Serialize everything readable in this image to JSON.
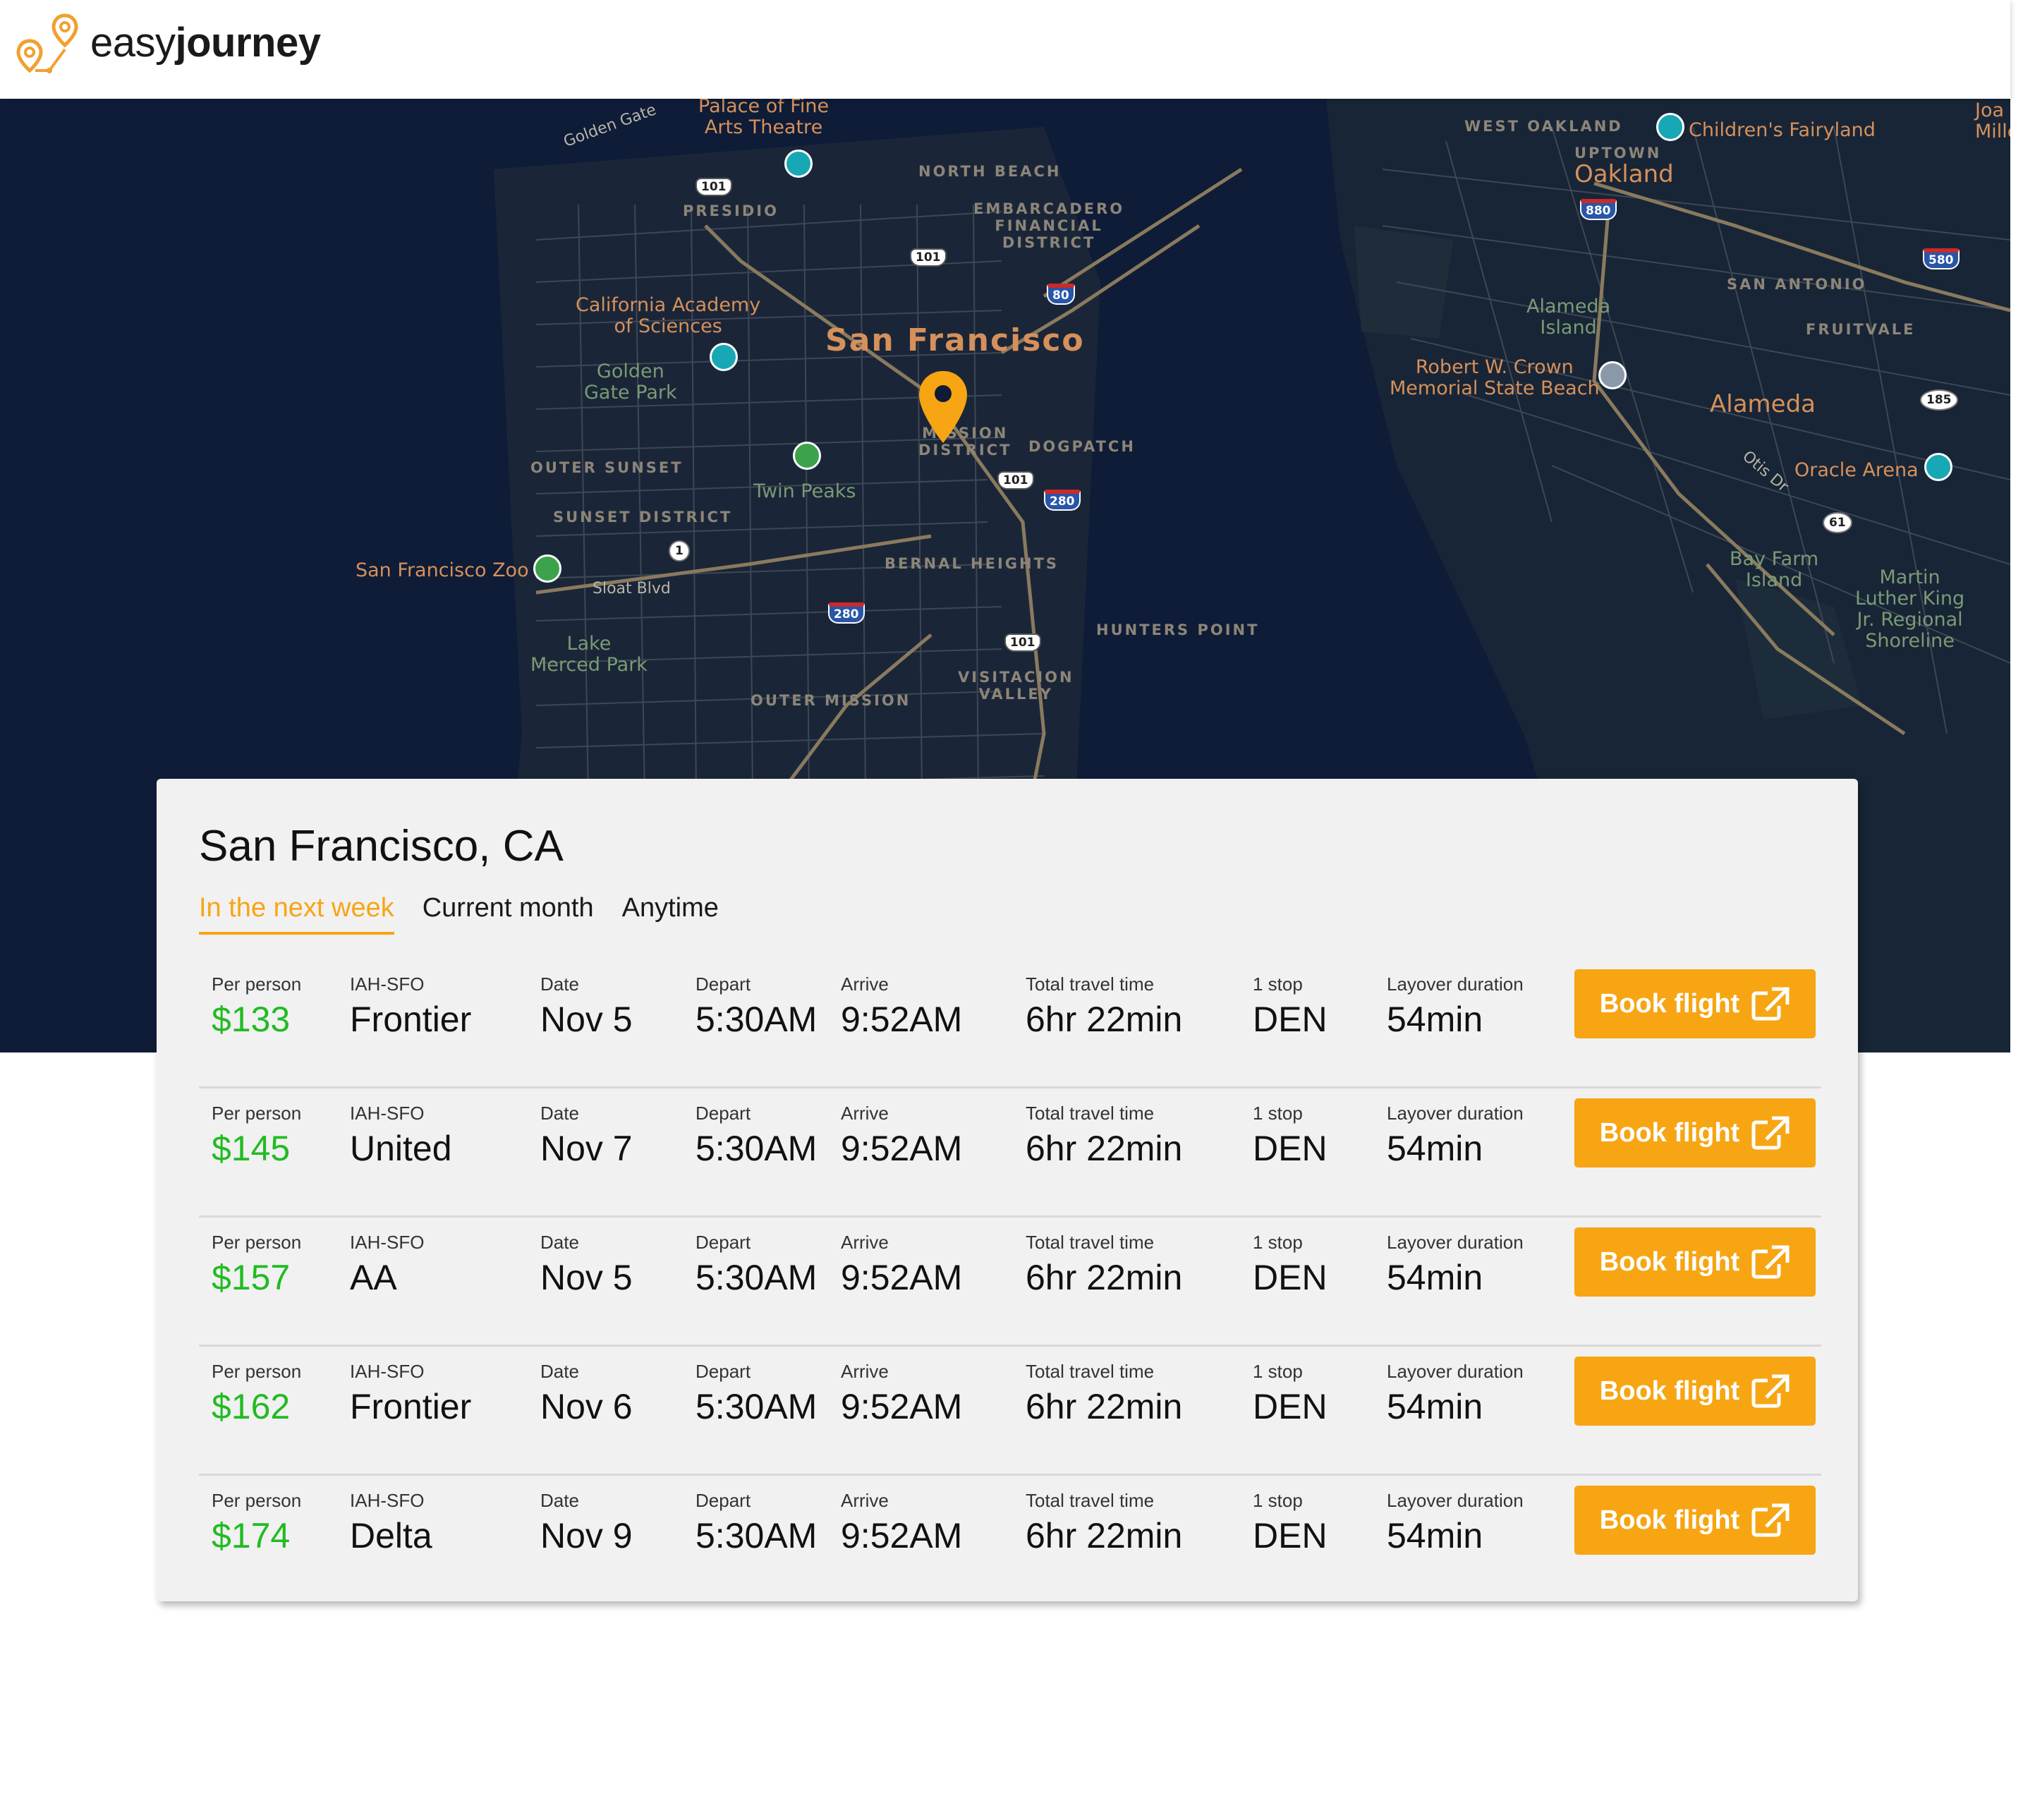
{
  "brand": {
    "name_light": "easy",
    "name_bold": "journey"
  },
  "map": {
    "labels": {
      "golden_gate": "Golden Gate",
      "palace": "Palace of Fine\nArts Theatre",
      "presidio": "PRESIDIO",
      "north_beach": "NORTH BEACH",
      "embarcadero": "EMBARCADERO\nFINANCIAL\nDISTRICT",
      "cal_academy": "California Academy\nof Sciences",
      "golden_gate_park": "Golden\nGate Park",
      "san_francisco": "San Francisco",
      "mission": "MISSION\nDISTRICT",
      "dogpatch": "DOGPATCH",
      "outer_sunset": "OUTER SUNSET",
      "twin_peaks": "Twin Peaks",
      "sunset_district": "SUNSET DISTRICT",
      "sf_zoo": "San Francisco Zoo",
      "sloat": "Sloat Blvd",
      "bernal": "BERNAL HEIGHTS",
      "hunters_point": "HUNTERS POINT",
      "lake_merced": "Lake\nMerced Park",
      "outer_mission": "OUTER MISSION",
      "visitacion": "VISITACION\nVALLEY",
      "west_oakland": "WEST OAKLAND",
      "uptown": "UPTOWN",
      "oakland": "Oakland",
      "childrens_fairyland": "Children's Fairyland",
      "joaquin": "Joa\nMille",
      "san_antonio": "SAN ANTONIO",
      "fruitvale": "FRUITVALE",
      "alameda_island": "Alameda\nIsland",
      "robert_crown": "Robert W. Crown\nMemorial State Beach",
      "alameda": "Alameda",
      "otis": "Otis Dr",
      "oracle": "Oracle Arena",
      "bay_farm": "Bay Farm\nIsland",
      "mlk": "Martin\nLuther King\nJr. Regional\nShoreline"
    },
    "shields": {
      "us101_a": "101",
      "us101_b": "101",
      "us101_c": "101",
      "us101_d": "101",
      "i80": "80",
      "i280_a": "280",
      "i280_b": "280",
      "i880": "880",
      "i580": "580",
      "ca1": "1",
      "ca185": "185",
      "ca61": "61"
    }
  },
  "card": {
    "title": "San Francisco, CA",
    "tabs": [
      {
        "label": "In the next week",
        "active": true
      },
      {
        "label": "Current month",
        "active": false
      },
      {
        "label": "Anytime",
        "active": false
      }
    ],
    "labels": {
      "per_person": "Per person",
      "date": "Date",
      "depart": "Depart",
      "arrive": "Arrive",
      "total": "Total travel time",
      "stops": "1 stop",
      "layover": "Layover duration",
      "book": "Book flight"
    },
    "flights": [
      {
        "price": "$133",
        "route": "IAH-SFO",
        "airline": "Frontier",
        "date": "Nov 5",
        "depart": "5:30AM",
        "arrive": "9:52AM",
        "total": "6hr 22min",
        "stop": "DEN",
        "layover": "54min"
      },
      {
        "price": "$145",
        "route": "IAH-SFO",
        "airline": "United",
        "date": "Nov 7",
        "depart": "5:30AM",
        "arrive": "9:52AM",
        "total": "6hr 22min",
        "stop": "DEN",
        "layover": "54min"
      },
      {
        "price": "$157",
        "route": "IAH-SFO",
        "airline": "AA",
        "date": "Nov 5",
        "depart": "5:30AM",
        "arrive": "9:52AM",
        "total": "6hr 22min",
        "stop": "DEN",
        "layover": "54min"
      },
      {
        "price": "$162",
        "route": "IAH-SFO",
        "airline": "Frontier",
        "date": "Nov 6",
        "depart": "5:30AM",
        "arrive": "9:52AM",
        "total": "6hr 22min",
        "stop": "DEN",
        "layover": "54min"
      },
      {
        "price": "$174",
        "route": "IAH-SFO",
        "airline": "Delta",
        "date": "Nov 9",
        "depart": "5:30AM",
        "arrive": "9:52AM",
        "total": "6hr 22min",
        "stop": "DEN",
        "layover": "54min"
      }
    ]
  },
  "colors": {
    "accent": "#f7a513",
    "price": "#22bb22",
    "map_bg": "#0e1c37"
  },
  "icons": {
    "logo": "map-pin-route-icon",
    "location": "map-pin-icon",
    "external": "external-link-icon"
  }
}
